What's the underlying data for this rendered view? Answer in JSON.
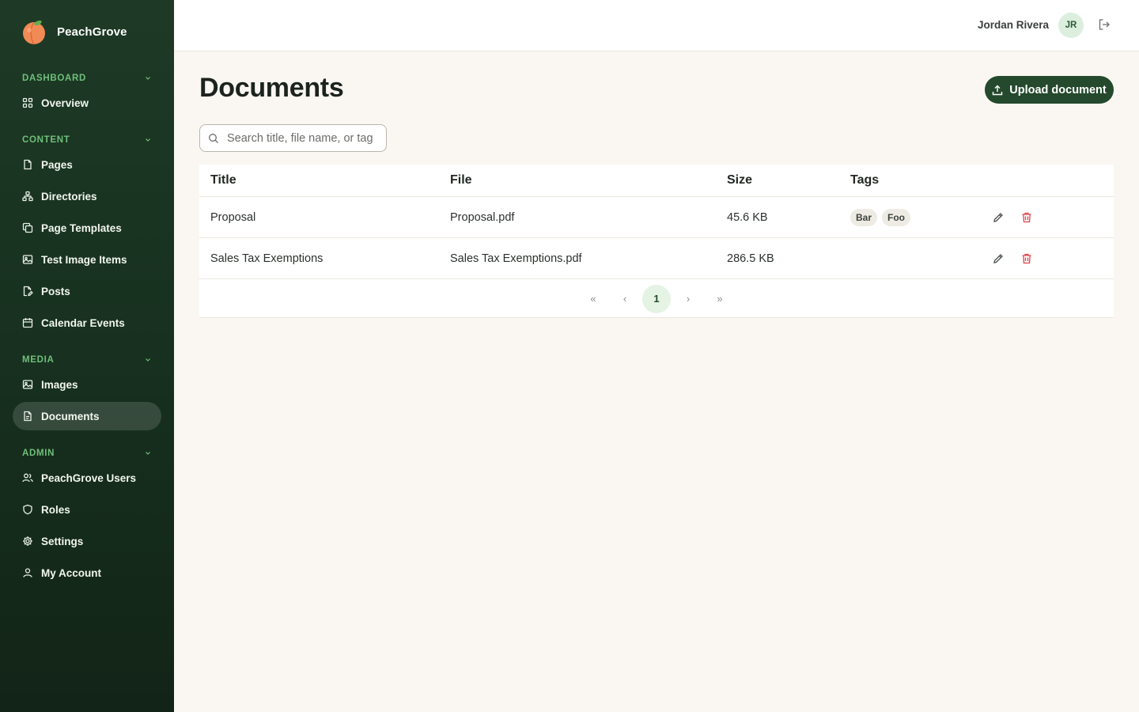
{
  "brand": {
    "name": "PeachGrove"
  },
  "sidebar": {
    "sections": [
      {
        "label": "DASHBOARD",
        "items": [
          {
            "label": "Overview",
            "icon": "grid-icon"
          }
        ]
      },
      {
        "label": "CONTENT",
        "items": [
          {
            "label": "Pages",
            "icon": "file-icon"
          },
          {
            "label": "Directories",
            "icon": "sitemap-icon"
          },
          {
            "label": "Page Templates",
            "icon": "copy-icon"
          },
          {
            "label": "Test Image Items",
            "icon": "image-icon"
          },
          {
            "label": "Posts",
            "icon": "file-edit-icon"
          },
          {
            "label": "Calendar Events",
            "icon": "calendar-icon"
          }
        ]
      },
      {
        "label": "MEDIA",
        "items": [
          {
            "label": "Images",
            "icon": "image-icon"
          },
          {
            "label": "Documents",
            "icon": "document-icon",
            "active": true
          }
        ]
      },
      {
        "label": "ADMIN",
        "items": [
          {
            "label": "PeachGrove Users",
            "icon": "users-icon"
          },
          {
            "label": "Roles",
            "icon": "shield-icon"
          },
          {
            "label": "Settings",
            "icon": "gear-icon"
          },
          {
            "label": "My Account",
            "icon": "user-icon"
          }
        ]
      }
    ]
  },
  "topbar": {
    "user_name": "Jordan Rivera",
    "avatar_initials": "JR",
    "logout_icon": "logout-icon"
  },
  "main": {
    "title": "Documents",
    "upload_label": "Upload document",
    "search": {
      "placeholder": "Search title, file name, or tag",
      "value": ""
    },
    "table": {
      "columns": [
        "Title",
        "File",
        "Size",
        "Tags"
      ],
      "rows": [
        {
          "title": "Proposal",
          "file": "Proposal.pdf",
          "size": "45.6 KB",
          "tags": [
            "Bar",
            "Foo"
          ]
        },
        {
          "title": "Sales Tax Exemptions",
          "file": "Sales Tax Exemptions.pdf",
          "size": "286.5 KB",
          "tags": []
        }
      ]
    },
    "pagination": {
      "first": "«",
      "prev": "‹",
      "current": "1",
      "next": "›",
      "last": "»"
    }
  },
  "colors": {
    "sidebar_bg": "#1e3a26",
    "accent": "#24492d",
    "section_label": "#6fbf7a",
    "danger": "#e0444b"
  }
}
